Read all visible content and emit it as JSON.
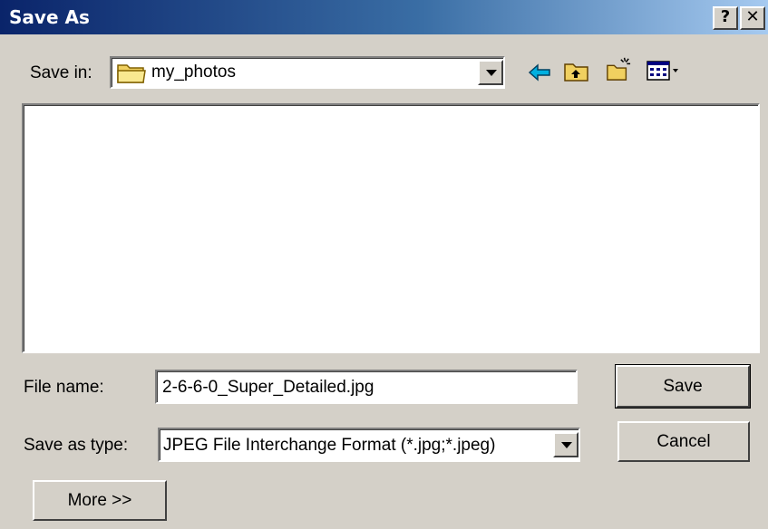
{
  "window": {
    "title": "Save As",
    "help_glyph": "?",
    "close_glyph": "✕"
  },
  "save_in": {
    "label": "Save in:",
    "value": "my_photos",
    "icon": "folder-icon"
  },
  "toolbar": {
    "icons": [
      "back-arrow-icon",
      "up-one-level-icon",
      "new-folder-icon",
      "view-menu-icon"
    ]
  },
  "file_list": {
    "items": []
  },
  "file_name": {
    "label": "File name:",
    "value": "2-6-6-0_Super_Detailed.jpg"
  },
  "save_as_type": {
    "label": "Save as type:",
    "value": "JPEG File Interchange Format (*.jpg;*.jpeg)"
  },
  "buttons": {
    "save": "Save",
    "cancel": "Cancel",
    "more": "More >>"
  },
  "colors": {
    "title_gradient_start": "#0a246a",
    "title_gradient_end": "#a6caf0",
    "face": "#d4d0c8",
    "back_arrow": "#00a0d0",
    "folder": "#f0d060"
  }
}
